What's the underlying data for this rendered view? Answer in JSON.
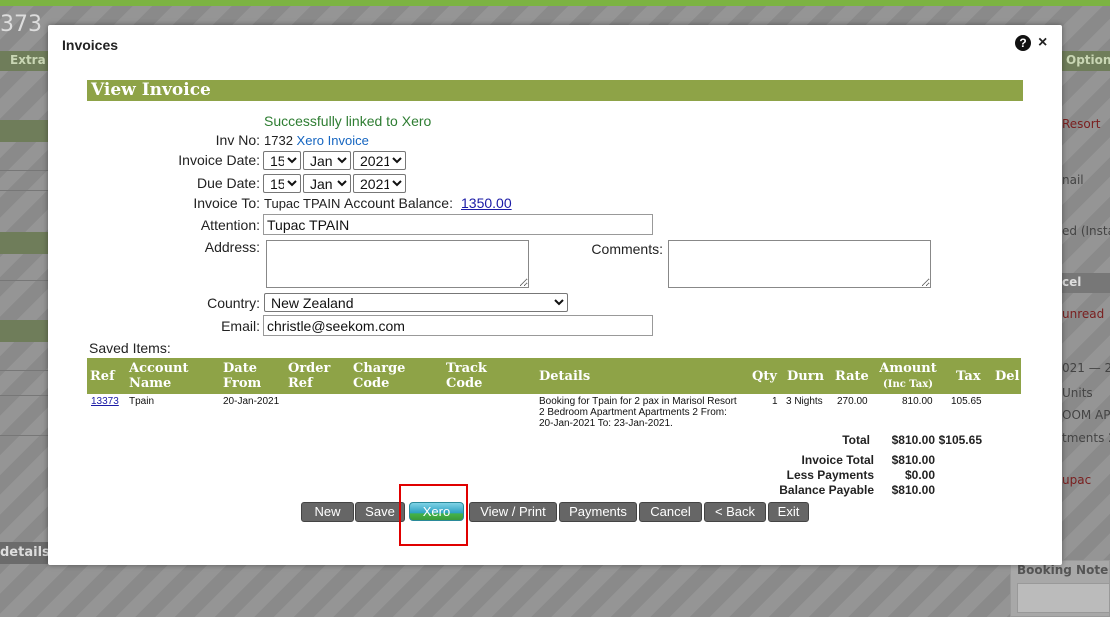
{
  "background": {
    "page_title": "373",
    "tab_left": "Extra",
    "tab_right": "Options",
    "details_label": "details",
    "right_panel": [
      "Resort",
      "nail",
      "ed (Instan",
      "cel",
      "unread",
      "021 — 2",
      "Units",
      "OOM AP",
      "tments 2",
      "upac"
    ],
    "booking_notes": "Booking Notes ("
  },
  "dialog": {
    "title": "Invoices",
    "help_icon": "?",
    "close_icon": "×",
    "section_title": "View Invoice",
    "success_message": "Successfully linked to Xero",
    "inv_no_label": "Inv No:",
    "inv_no": "1732",
    "xero_invoice_link": "Xero Invoice",
    "invoice_date_label": "Invoice Date:",
    "invoice_date": {
      "day": "15",
      "month": "Jan",
      "year": "2021"
    },
    "due_date_label": "Due Date:",
    "due_date": {
      "day": "15",
      "month": "Jan",
      "year": "2021"
    },
    "invoice_to_label": "Invoice To:",
    "invoice_to": "Tupac TPAIN",
    "account_balance_label": "Account Balance:",
    "account_balance": "1350.00",
    "attention_label": "Attention:",
    "attention": "Tupac TPAIN",
    "address_label": "Address:",
    "comments_label": "Comments:",
    "country_label": "Country:",
    "country": "New Zealand",
    "email_label": "Email:",
    "email": "christle@seekom.com",
    "saved_items_label": "Saved Items:"
  },
  "table": {
    "headers": {
      "ref": "Ref",
      "account_name": "Account Name",
      "date_from": "Date From",
      "order_ref": "Order Ref",
      "charge_code": "Charge Code",
      "track_code": "Track Code",
      "details": "Details",
      "qty": "Qty",
      "durn": "Durn",
      "rate": "Rate",
      "amount": "Amount",
      "amount_sub": "(Inc Tax)",
      "tax": "Tax",
      "del": "Del"
    },
    "rows": [
      {
        "ref": "13373",
        "account_name": "Tpain",
        "date_from": "20-Jan-2021",
        "details": "Booking for Tpain for 2 pax in Marisol Resort 2 Bedroom Apartment Apartments 2 From: 20-Jan-2021 To: 23-Jan-2021.",
        "qty": "1",
        "durn": "3 Nights",
        "rate": "270.00",
        "amount": "810.00",
        "tax": "105.65"
      }
    ],
    "total_label": "Total",
    "total_amount": "$810.00",
    "total_tax": "$105.65"
  },
  "summary": {
    "invoice_total_label": "Invoice Total",
    "invoice_total": "$810.00",
    "less_payments_label": "Less Payments",
    "less_payments": "$0.00",
    "balance_payable_label": "Balance Payable",
    "balance_payable": "$810.00"
  },
  "buttons": {
    "new": "New",
    "save": "Save",
    "xero": "Xero",
    "view_print": "View / Print",
    "payments": "Payments",
    "cancel": "Cancel",
    "back": "< Back",
    "exit": "Exit"
  },
  "colors": {
    "section_green": "#8ea347",
    "success_green": "#2e7d32",
    "highlight_red": "#e00000"
  }
}
